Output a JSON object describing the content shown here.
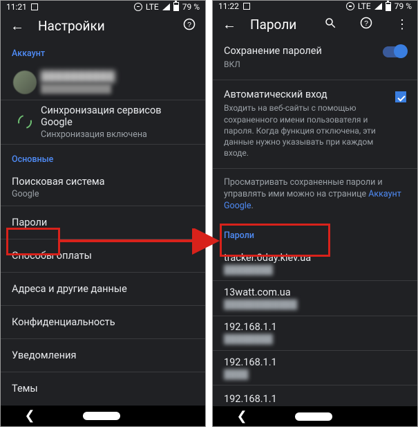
{
  "left": {
    "status": {
      "time": "11:21",
      "net": "LTE",
      "battery": "79 %"
    },
    "appbar": {
      "title": "Настройки"
    },
    "sections": {
      "account": "Аккаунт",
      "main": "Основные"
    },
    "account_row": {
      "name": "██████████",
      "email": "████████████"
    },
    "sync_row": {
      "title": "Синхронизация сервисов Google",
      "sub": "Синхронизация включена"
    },
    "search": {
      "title": "Поисковая система",
      "sub": "Google"
    },
    "passwords": "Пароли",
    "payments": "Способы оплаты",
    "addresses": "Адреса и другие данные",
    "privacy": "Конфиденциальность",
    "notifications": "Уведомления",
    "themes": "Темы"
  },
  "right": {
    "status": {
      "time": "11:22",
      "net": "LTE",
      "battery": "79 %"
    },
    "appbar": {
      "title": "Пароли"
    },
    "save_row": {
      "title": "Сохранение паролей",
      "sub": "ВКЛ"
    },
    "auto_row": {
      "title": "Автоматический вход",
      "desc": "Входить на веб-сайты с помощью сохраненного имени пользователя и пароля. Когда функция отключена, эти данные нужно указывать при каждом входе."
    },
    "info": {
      "text_a": "Просматривать сохраненные пароли и управлять ими можно на странице ",
      "link": "Аккаунт Google",
      "text_b": "."
    },
    "section": "Пароли",
    "items": [
      {
        "site": "tracker.0day.kiev.ua",
        "user": "████████"
      },
      {
        "site": "13watt.com.ua",
        "user": "████████████"
      },
      {
        "site": "192.168.1.1",
        "user": "████████"
      },
      {
        "site": "192.168.1.1",
        "user": "████"
      },
      {
        "site": "192.168.1.1",
        "user": ""
      }
    ]
  }
}
